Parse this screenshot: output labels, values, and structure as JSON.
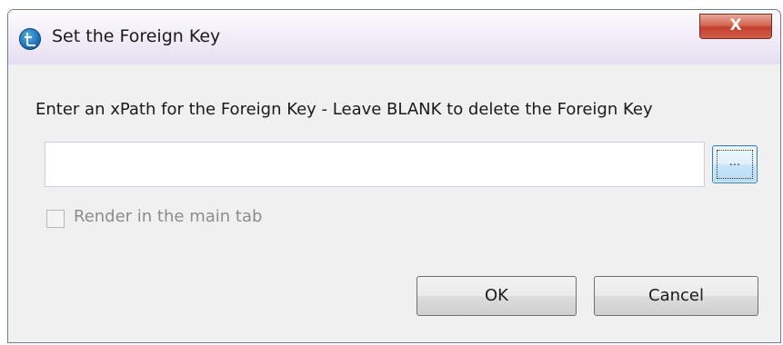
{
  "window": {
    "title": "Set the Foreign Key",
    "close_label": "X"
  },
  "dialog": {
    "prompt": "Enter an xPath for the Foreign Key - Leave BLANK to delete the Foreign Key",
    "xpath_value": "",
    "browse_label": "...",
    "render_main_tab_label": "Render in the main tab",
    "render_main_tab_checked": false,
    "ok_label": "OK",
    "cancel_label": "Cancel"
  },
  "icons": {
    "app": "talend-app-icon",
    "close": "close-icon"
  },
  "colors": {
    "close_button": "#c2402b",
    "browse_button_border": "#3c7fb1",
    "dialog_background": "#f0f0f0"
  }
}
